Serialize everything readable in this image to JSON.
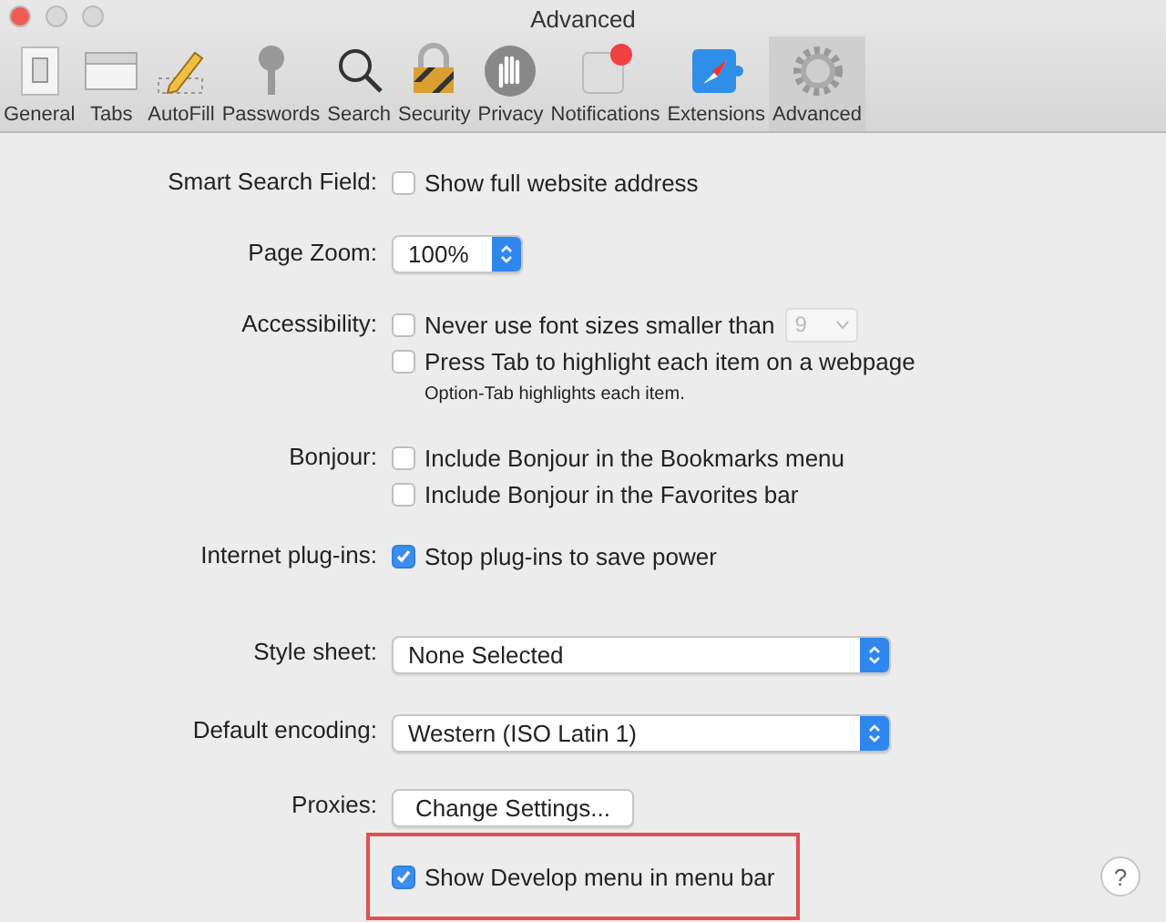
{
  "window": {
    "title": "Advanced"
  },
  "toolbar": [
    {
      "label": "General",
      "selected": false
    },
    {
      "label": "Tabs",
      "selected": false
    },
    {
      "label": "AutoFill",
      "selected": false
    },
    {
      "label": "Passwords",
      "selected": false
    },
    {
      "label": "Search",
      "selected": false
    },
    {
      "label": "Security",
      "selected": false
    },
    {
      "label": "Privacy",
      "selected": false
    },
    {
      "label": "Notifications",
      "selected": false
    },
    {
      "label": "Extensions",
      "selected": false
    },
    {
      "label": "Advanced",
      "selected": true
    }
  ],
  "sections": [
    {
      "label": "Smart Search Field:",
      "controls": [
        {
          "kind": "checkbox",
          "text": "Show full website address",
          "checked": false
        }
      ]
    },
    {
      "label": "Page Zoom:",
      "controls": [
        {
          "kind": "stepper",
          "value": "100%"
        }
      ]
    },
    {
      "label": "Accessibility:",
      "controls": [
        {
          "kind": "checkbox",
          "text": "Never use font sizes smaller than",
          "checked": false,
          "popup": {
            "value": "9",
            "disabled": true
          }
        },
        {
          "kind": "checkbox",
          "text": "Press Tab to highlight each item on a webpage",
          "checked": false
        },
        {
          "kind": "note",
          "text": "Option-Tab highlights each item."
        }
      ]
    },
    {
      "label": "Bonjour:",
      "controls": [
        {
          "kind": "checkbox",
          "text": "Include Bonjour in the Bookmarks menu",
          "checked": false
        },
        {
          "kind": "checkbox",
          "text": "Include Bonjour in the Favorites bar",
          "checked": false
        }
      ]
    },
    {
      "label": "Internet plug-ins:",
      "controls": [
        {
          "kind": "checkbox",
          "text": "Stop plug-ins to save power",
          "checked": true
        }
      ]
    },
    {
      "label": "Style sheet:",
      "controls": [
        {
          "kind": "popup",
          "value": "None Selected"
        }
      ]
    },
    {
      "label": "Default encoding:",
      "controls": [
        {
          "kind": "popup",
          "value": "Western (ISO Latin 1)"
        }
      ]
    },
    {
      "label": "Proxies:",
      "controls": [
        {
          "kind": "button",
          "text": "Change Settings..."
        }
      ]
    },
    {
      "controls": [
        {
          "kind": "checkbox",
          "text": "Show Develop menu in menu bar",
          "checked": true,
          "highlighted": true
        }
      ]
    }
  ],
  "help": "?"
}
